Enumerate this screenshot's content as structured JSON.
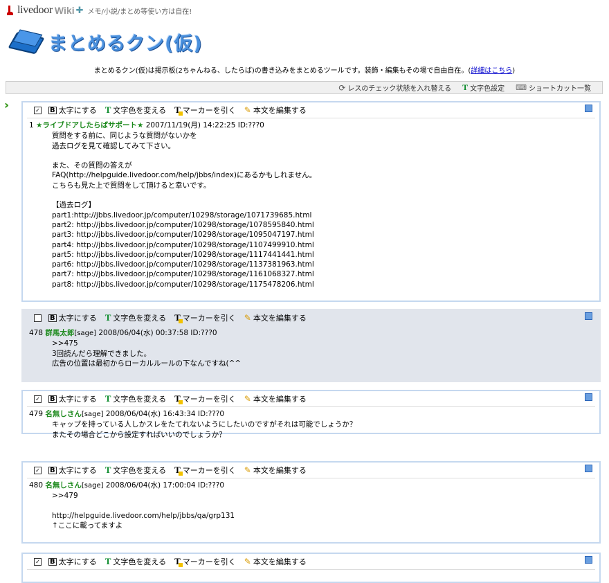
{
  "header": {
    "logo_text": "livedoor",
    "logo_wiki": "Wiki",
    "tagline": "メモ/小説/まとめ等使い方は自在!"
  },
  "title": "まとめるクン(仮)",
  "description": {
    "text": "まとめるクン(仮)は掲示板(2ちゃんねる、したらば)の書き込みをまとめるツールです。装飾・編集もその場で自由自在。",
    "link_open": "(",
    "link": "詳細はこちら",
    "link_close": ")"
  },
  "toolbar": {
    "reset_label": "レスのチェック状態を入れ替える",
    "color_label": "文字色設定",
    "shortcut_label": "ショートカット一覧"
  },
  "post_tools": {
    "bold": "太字にする",
    "color": "文字色を変える",
    "marker": "マーカーを引く",
    "edit": "本文を編集する"
  },
  "posts": [
    {
      "num": "1",
      "name": "★ライブドアしたらばサポート★",
      "sage": "",
      "meta": "2007/11/19(月) 14:22:25 ID:???0",
      "checked": true,
      "lines": [
        "質問をする前に、同じような質問がないかを",
        "過去ログを見て確認してみて下さい。",
        "",
        "また、その質問の答えが",
        "FAQ(http://helpguide.livedoor.com/help/jbbs/index)にあるかもしれません。",
        "こちらも見た上で質問をして頂けると幸いです。",
        "",
        "【過去ログ】",
        "part1:http://jbbs.livedoor.jp/computer/10298/storage/1071739685.html",
        "part2: http://jbbs.livedoor.jp/computer/10298/storage/1078595840.html",
        "part3: http://jbbs.livedoor.jp/computer/10298/storage/1095047197.html",
        "part4: http://jbbs.livedoor.jp/computer/10298/storage/1107499910.html",
        "part5: http://jbbs.livedoor.jp/computer/10298/storage/1117441441.html",
        "part6: http://jbbs.livedoor.jp/computer/10298/storage/1137381963.html",
        "part7: http://jbbs.livedoor.jp/computer/10298/storage/1161068327.html",
        "part8: http://jbbs.livedoor.jp/computer/10298/storage/1175478206.html"
      ]
    },
    {
      "num": "478",
      "name": "群馬太郎",
      "sage": "[sage]",
      "meta": "2008/06/04(水) 00:37:58 ID:???0",
      "checked": false,
      "lines": [
        ">>475",
        "3回読んだら理解できました。",
        "広告の位置は最初からローカルルールの下なんですね(^^"
      ]
    },
    {
      "num": "479",
      "name": "名無しさん",
      "sage": "[sage]",
      "meta": "2008/06/04(水) 16:43:34 ID:???0",
      "checked": true,
      "lines": [
        "キャップを持っている人しかスレをたてれないようにしたいのですがそれは可能でしょうか？",
        "またその場合どこから設定すればいいのでしょうか？"
      ]
    },
    {
      "num": "480",
      "name": "名無しさん",
      "sage": "[sage]",
      "meta": "2008/06/04(水) 17:00:04 ID:???0",
      "checked": true,
      "lines": [
        ">>479",
        "",
        "http://helpguide.livedoor.com/help/jbbs/qa/grp131",
        "↑ここに載ってますよ"
      ]
    },
    {
      "num": "",
      "name": "",
      "sage": "",
      "meta": "",
      "checked": true,
      "lines": []
    }
  ],
  "icons": {
    "logo": "livedoor-logo-icon",
    "puzzle": "puzzle-icon",
    "book": "book-icon",
    "refresh": "refresh-icon",
    "text_color": "text-color-icon",
    "keyboard": "keyboard-icon",
    "current_arrow": "double-arrow-icon",
    "bold": "bold-icon",
    "marker": "marker-icon",
    "pencil": "pencil-icon",
    "corner": "square-icon"
  },
  "colors": {
    "name_green": "#1d8a1d",
    "post_border": "#c5d8ef",
    "shaded_bg": "#e1e5ec",
    "title_blue": "#4a90dd",
    "link_blue": "#0000cc"
  }
}
